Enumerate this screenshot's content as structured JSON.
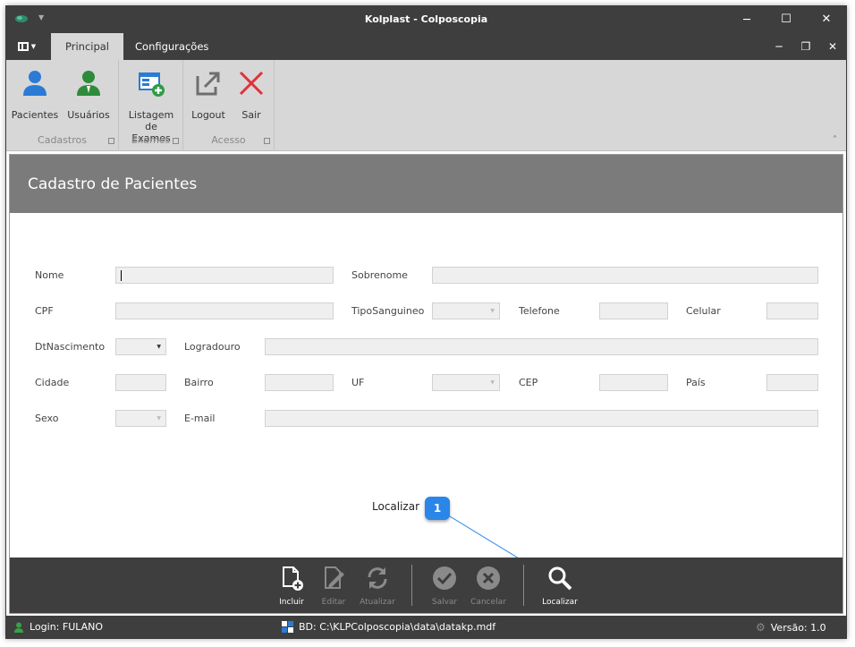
{
  "window": {
    "title": "Kolplast - Colposcopia",
    "controls": {
      "minimize": "─",
      "maximize": "☐",
      "close": "✕"
    },
    "mdi_controls": {
      "minimize": "─",
      "restore": "❐",
      "close": "✕"
    }
  },
  "tabs": [
    {
      "label": "Principal",
      "active": true
    },
    {
      "label": "Configurações",
      "active": false
    }
  ],
  "ribbon": {
    "groups": [
      {
        "label": "Cadastros",
        "buttons": [
          {
            "label": "Pacientes",
            "icon": "user-blue-icon"
          },
          {
            "label": "Usuários",
            "icon": "user-green-icon"
          }
        ]
      },
      {
        "label": "Exames",
        "buttons": [
          {
            "label": "Listagem de Exames",
            "line1": "Listagem",
            "line2": "de Exames",
            "icon": "list-add-icon"
          }
        ]
      },
      {
        "label": "Acesso",
        "buttons": [
          {
            "label": "Logout",
            "icon": "logout-icon"
          },
          {
            "label": "Sair",
            "icon": "exit-x-icon"
          }
        ]
      }
    ],
    "collapse_glyph": "˄"
  },
  "form": {
    "title": "Cadastro de Pacientes",
    "labels": {
      "nome": "Nome",
      "sobrenome": "Sobrenome",
      "cpf": "CPF",
      "tipo_sanguineo": "TipoSanguineo",
      "telefone": "Telefone",
      "celular": "Celular",
      "dt_nascimento": "DtNascimento",
      "logradouro": "Logradouro",
      "cidade": "Cidade",
      "bairro": "Bairro",
      "uf": "UF",
      "cep": "CEP",
      "pais": "País",
      "sexo": "Sexo",
      "email": "E-mail"
    },
    "values": {
      "nome": "",
      "sobrenome": "",
      "cpf": "",
      "tipo_sanguineo": "",
      "telefone": "",
      "celular": "",
      "dt_nascimento": "",
      "logradouro": "",
      "cidade": "",
      "bairro": "",
      "uf": "",
      "cep": "",
      "pais": "",
      "sexo": "",
      "email": ""
    }
  },
  "callout": {
    "label": "Localizar",
    "number": "1"
  },
  "toolbar": [
    {
      "label": "Incluir",
      "enabled": true
    },
    {
      "label": "Editar",
      "enabled": false
    },
    {
      "label": "Atualizar",
      "enabled": false
    },
    {
      "label": "Salvar",
      "enabled": false
    },
    {
      "label": "Cancelar",
      "enabled": false
    },
    {
      "label": "Localizar",
      "enabled": true
    }
  ],
  "status": {
    "login": "Login: FULANO",
    "database": "BD: C:\\KLPColposcopia\\data\\datakp.mdf",
    "version": "Versão: 1.0"
  },
  "colors": {
    "chrome": "#3e3e3e",
    "ribbon": "#d7d7d7",
    "header": "#7b7b7b",
    "blue_icon": "#2b7bd6",
    "green_icon": "#2e8b3a",
    "red_x": "#e0313a",
    "callout": "#2a86e8"
  }
}
